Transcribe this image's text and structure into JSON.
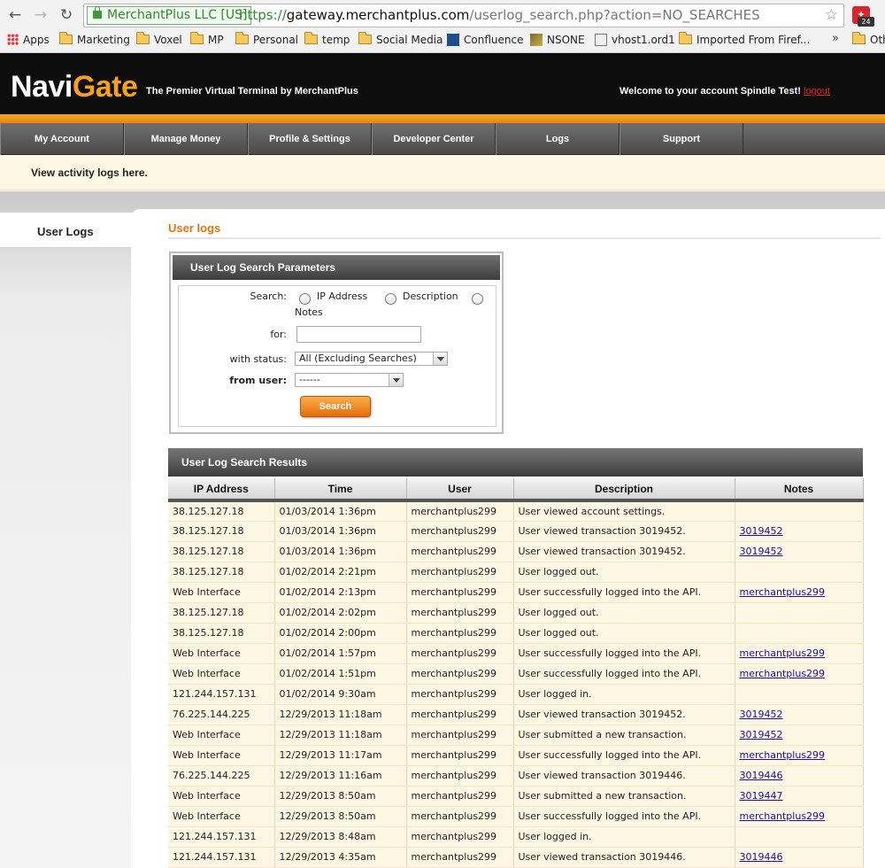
{
  "browser": {
    "ev_label": "MerchantPlus LLC [US]",
    "url_scheme": "https://",
    "url_host": "gateway.merchantplus.com",
    "url_path": "/userlog_search.php?action=NO_SEARCHES",
    "extension_badge": "24",
    "bookmarks": [
      {
        "label": "Apps",
        "icon": "apps-grid-icon"
      },
      {
        "label": "Marketing",
        "icon": "folder-icon"
      },
      {
        "label": "Voxel",
        "icon": "folder-icon"
      },
      {
        "label": "MP",
        "icon": "folder-icon"
      },
      {
        "label": "Personal",
        "icon": "folder-icon"
      },
      {
        "label": "temp",
        "icon": "folder-icon"
      },
      {
        "label": "Social Media",
        "icon": "folder-icon"
      },
      {
        "label": "Confluence",
        "icon": "confluence-icon"
      },
      {
        "label": "NSONE",
        "icon": "nsone-icon"
      },
      {
        "label": "vhost1.ord1",
        "icon": "page-icon"
      },
      {
        "label": "Imported From Firef...",
        "icon": "folder-icon"
      },
      {
        "label": "Oth",
        "icon": "folder-icon"
      }
    ],
    "more_label": "»"
  },
  "header": {
    "logo_navi": "Navi",
    "logo_gate": "Gate",
    "tagline": "The Premier Virtual Terminal by MerchantPlus",
    "welcome": "Welcome to your account Spindle Test!",
    "logout": "logout"
  },
  "nav": [
    "My Account",
    "Manage Money",
    "Profile & Settings",
    "Developer Center",
    "Logs",
    "Support"
  ],
  "info_text": "View activity logs here.",
  "sidebar": {
    "tab": "User Logs"
  },
  "page_title": "User logs",
  "search": {
    "heading": "User Log Search Parameters",
    "search_label": "Search:",
    "options": [
      "IP Address",
      "Description",
      "Notes"
    ],
    "for_label": "for:",
    "for_value": "",
    "status_label": "with status:",
    "status_value": "All (Excluding Searches)",
    "user_label": "from user:",
    "user_value": "------",
    "button": "Search"
  },
  "results": {
    "heading": "User Log Search Results",
    "columns": [
      "IP Address",
      "Time",
      "User",
      "Description",
      "Notes"
    ],
    "rows": [
      [
        "38.125.127.18",
        "01/03/2014 1:36pm",
        "merchantplus299",
        "User viewed account settings.",
        ""
      ],
      [
        "38.125.127.18",
        "01/03/2014 1:36pm",
        "merchantplus299",
        "User viewed transaction 3019452.",
        "3019452"
      ],
      [
        "38.125.127.18",
        "01/03/2014 1:36pm",
        "merchantplus299",
        "User viewed transaction 3019452.",
        "3019452"
      ],
      [
        "38.125.127.18",
        "01/02/2014 2:21pm",
        "merchantplus299",
        "User logged out.",
        ""
      ],
      [
        "Web Interface",
        "01/02/2014 2:13pm",
        "merchantplus299",
        "User successfully logged into the API.",
        "merchantplus299"
      ],
      [
        "38.125.127.18",
        "01/02/2014 2:02pm",
        "merchantplus299",
        "User logged out.",
        ""
      ],
      [
        "38.125.127.18",
        "01/02/2014 2:00pm",
        "merchantplus299",
        "User logged out.",
        ""
      ],
      [
        "Web Interface",
        "01/02/2014 1:57pm",
        "merchantplus299",
        "User successfully logged into the API.",
        "merchantplus299"
      ],
      [
        "Web Interface",
        "01/02/2014 1:51pm",
        "merchantplus299",
        "User successfully logged into the API.",
        "merchantplus299"
      ],
      [
        "121.244.157.131",
        "01/02/2014 9:30am",
        "merchantplus299",
        "User logged in.",
        ""
      ],
      [
        "76.225.144.225",
        "12/29/2013 11:18am",
        "merchantplus299",
        "User viewed transaction 3019452.",
        "3019452"
      ],
      [
        "Web Interface",
        "12/29/2013 11:18am",
        "merchantplus299",
        "User submitted a new transaction.",
        "3019452"
      ],
      [
        "Web Interface",
        "12/29/2013 11:17am",
        "merchantplus299",
        "User successfully logged into the API.",
        "merchantplus299"
      ],
      [
        "76.225.144.225",
        "12/29/2013 11:16am",
        "merchantplus299",
        "User viewed transaction 3019446.",
        "3019446"
      ],
      [
        "Web Interface",
        "12/29/2013 8:50am",
        "merchantplus299",
        "User submitted a new transaction.",
        "3019447"
      ],
      [
        "Web Interface",
        "12/29/2013 8:50am",
        "merchantplus299",
        "User successfully logged into the API.",
        "merchantplus299"
      ],
      [
        "121.244.157.131",
        "12/29/2013 8:48am",
        "merchantplus299",
        "User logged in.",
        ""
      ],
      [
        "121.244.157.131",
        "12/29/2013 4:35am",
        "merchantplus299",
        "User viewed transaction 3019446.",
        "3019446"
      ]
    ]
  }
}
